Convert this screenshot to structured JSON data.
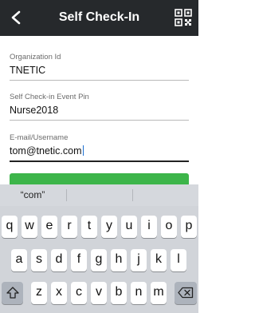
{
  "header": {
    "title": "Self Check-In",
    "back_icon": "chevron-left-icon",
    "qr_icon": "qr-code-icon"
  },
  "form": {
    "fields": [
      {
        "label": "Organization Id",
        "value": "TNETIC"
      },
      {
        "label": "Self Check-in Event Pin",
        "value": "Nurse2018"
      },
      {
        "label": "E-mail/Username",
        "value": "tom@tnetic.com"
      }
    ]
  },
  "submit": {
    "color": "#3db54a"
  },
  "keyboard": {
    "predictions": [
      "“com”",
      "",
      ""
    ],
    "rows": [
      [
        "q",
        "w",
        "e",
        "r",
        "t",
        "y",
        "u",
        "i",
        "o",
        "p"
      ],
      [
        "a",
        "s",
        "d",
        "f",
        "g",
        "h",
        "j",
        "k",
        "l"
      ],
      [
        "z",
        "x",
        "c",
        "v",
        "b",
        "n",
        "m"
      ]
    ],
    "shift_icon": "shift-arrow-icon",
    "delete_icon": "backspace-icon"
  }
}
